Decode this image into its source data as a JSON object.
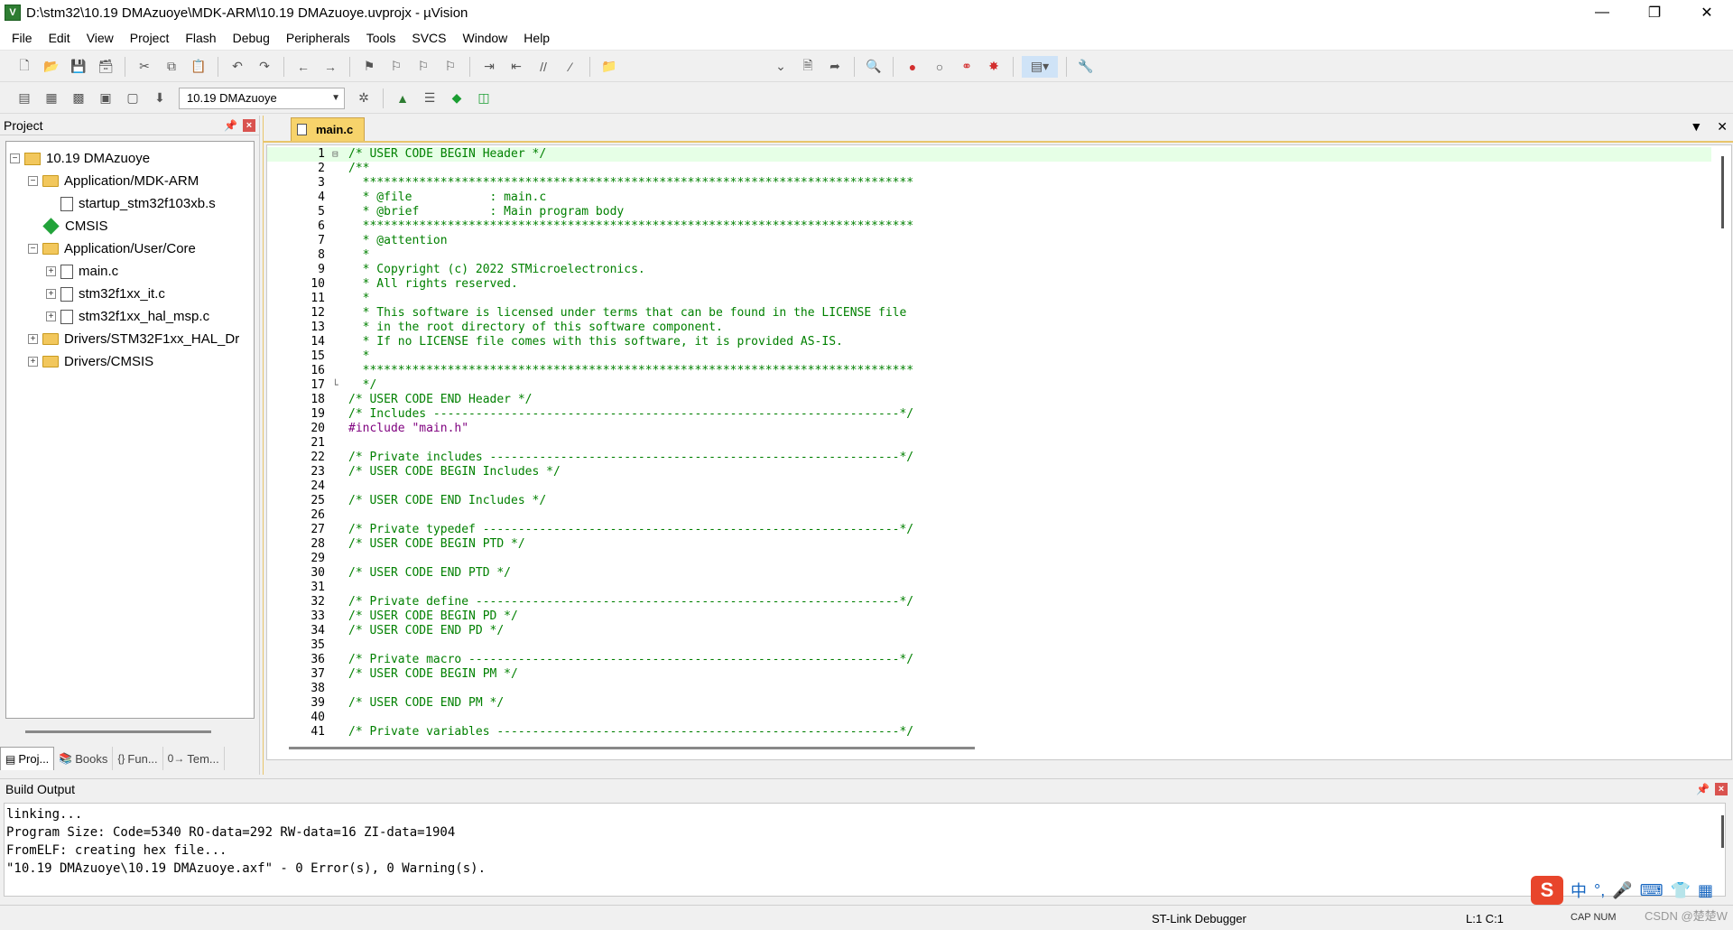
{
  "window": {
    "title": "D:\\stm32\\10.19 DMAzuoye\\MDK-ARM\\10.19 DMAzuoye.uvprojx - µVision"
  },
  "menu": [
    "File",
    "Edit",
    "View",
    "Project",
    "Flash",
    "Debug",
    "Peripherals",
    "Tools",
    "SVCS",
    "Window",
    "Help"
  ],
  "toolbar": {
    "target": "10.19 DMAzuoye"
  },
  "project_panel": {
    "title": "Project",
    "tree": [
      {
        "label": "10.19 DMAzuoye",
        "level": 0
      },
      {
        "label": "Application/MDK-ARM",
        "level": 1
      },
      {
        "label": "startup_stm32f103xb.s",
        "level": 2
      },
      {
        "label": "CMSIS",
        "level": 1
      },
      {
        "label": "Application/User/Core",
        "level": 1
      },
      {
        "label": "main.c",
        "level": 2
      },
      {
        "label": "stm32f1xx_it.c",
        "level": 2
      },
      {
        "label": "stm32f1xx_hal_msp.c",
        "level": 2
      },
      {
        "label": "Drivers/STM32F1xx_HAL_Dr",
        "level": 1
      },
      {
        "label": "Drivers/CMSIS",
        "level": 1
      }
    ],
    "tabs": [
      "Proj...",
      "Books",
      "Fun...",
      "Tem..."
    ]
  },
  "editor": {
    "tab": "main.c",
    "lines": [
      "/* USER CODE BEGIN Header */",
      "/**",
      "  ******************************************************************************",
      "  * @file           : main.c",
      "  * @brief          : Main program body",
      "  ******************************************************************************",
      "  * @attention",
      "  *",
      "  * Copyright (c) 2022 STMicroelectronics.",
      "  * All rights reserved.",
      "  *",
      "  * This software is licensed under terms that can be found in the LICENSE file",
      "  * in the root directory of this software component.",
      "  * If no LICENSE file comes with this software, it is provided AS-IS.",
      "  *",
      "  ******************************************************************************",
      "  */",
      "/* USER CODE END Header */",
      "/* Includes ------------------------------------------------------------------*/",
      "#include \"main.h\"",
      "",
      "/* Private includes ----------------------------------------------------------*/",
      "/* USER CODE BEGIN Includes */",
      "",
      "/* USER CODE END Includes */",
      "",
      "/* Private typedef -----------------------------------------------------------*/",
      "/* USER CODE BEGIN PTD */",
      "",
      "/* USER CODE END PTD */",
      "",
      "/* Private define ------------------------------------------------------------*/",
      "/* USER CODE BEGIN PD */",
      "/* USER CODE END PD */",
      "",
      "/* Private macro -------------------------------------------------------------*/",
      "/* USER CODE BEGIN PM */",
      "",
      "/* USER CODE END PM */",
      "",
      "/* Private variables ---------------------------------------------------------*/"
    ]
  },
  "build_output": {
    "title": "Build Output",
    "text": "linking...\nProgram Size: Code=5340 RO-data=292 RW-data=16 ZI-data=1904\nFromELF: creating hex file...\n\"10.19 DMAzuoye\\10.19 DMAzuoye.axf\" - 0 Error(s), 0 Warning(s)."
  },
  "status": {
    "debugger": "ST-Link Debugger",
    "position": "L:1 C:1",
    "caps": "CAP NUM"
  },
  "ime": {
    "lang": "中",
    "watermark": "CSDN @楚楚W"
  }
}
